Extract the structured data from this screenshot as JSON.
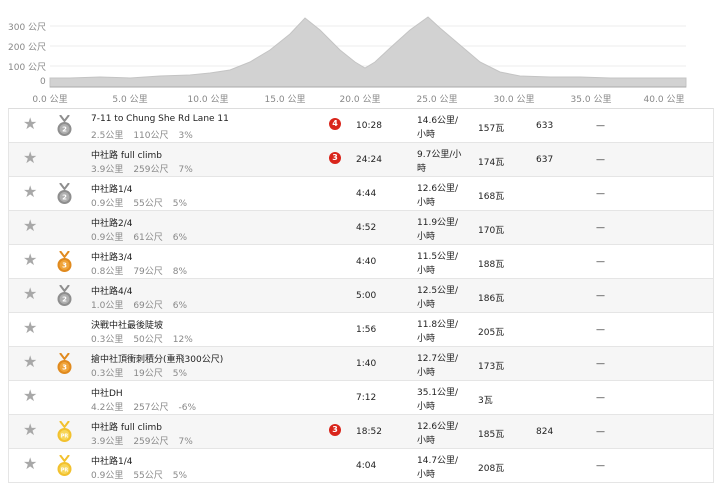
{
  "elevation": {
    "y_ticks": [
      "300 公尺",
      "200 公尺",
      "100 公尺",
      "0"
    ],
    "x_ticks": [
      "0.0 公里",
      "5.0 公里",
      "10.0 公里",
      "15.0 公里",
      "20.0 公里",
      "25.0 公里",
      "30.0 公里",
      "35.0 公里",
      "40.0 公里"
    ],
    "fill_color": "#d2d2d2"
  },
  "segments": [
    {
      "name": "7-11 to Chung She Rd Lane 11",
      "distance": "2.5公里",
      "elev": "110公尺",
      "grade": "3%",
      "medal": "silver",
      "medal_text": "2",
      "cat": "4",
      "time": "10:28",
      "speed1": "14.6公里/",
      "speed2": "小時",
      "power": "157瓦",
      "hr": "633",
      "vam": "—"
    },
    {
      "name": "中社路 full climb",
      "distance": "3.9公里",
      "elev": "259公尺",
      "grade": "7%",
      "medal": "",
      "medal_text": "",
      "cat": "3",
      "time": "24:24",
      "speed1": "9.7公里/小",
      "speed2": "時",
      "power": "174瓦",
      "hr": "637",
      "vam": "—"
    },
    {
      "name": "中社路1/4",
      "distance": "0.9公里",
      "elev": "55公尺",
      "grade": "5%",
      "medal": "silver",
      "medal_text": "2",
      "cat": "",
      "time": "4:44",
      "speed1": "12.6公里/",
      "speed2": "小時",
      "power": "168瓦",
      "hr": "",
      "vam": "—"
    },
    {
      "name": "中社路2/4",
      "distance": "0.9公里",
      "elev": "61公尺",
      "grade": "6%",
      "medal": "",
      "medal_text": "",
      "cat": "",
      "time": "4:52",
      "speed1": "11.9公里/",
      "speed2": "小時",
      "power": "170瓦",
      "hr": "",
      "vam": "—"
    },
    {
      "name": "中社路3/4",
      "distance": "0.8公里",
      "elev": "79公尺",
      "grade": "8%",
      "medal": "bronze",
      "medal_text": "3",
      "cat": "",
      "time": "4:40",
      "speed1": "11.5公里/",
      "speed2": "小時",
      "power": "188瓦",
      "hr": "",
      "vam": "—"
    },
    {
      "name": "中社路4/4",
      "distance": "1.0公里",
      "elev": "69公尺",
      "grade": "6%",
      "medal": "silver",
      "medal_text": "2",
      "cat": "",
      "time": "5:00",
      "speed1": "12.5公里/",
      "speed2": "小時",
      "power": "186瓦",
      "hr": "",
      "vam": "—"
    },
    {
      "name": "決戰中社最後陡坡",
      "distance": "0.3公里",
      "elev": "50公尺",
      "grade": "12%",
      "medal": "",
      "medal_text": "",
      "cat": "",
      "time": "1:56",
      "speed1": "11.8公里/",
      "speed2": "小時",
      "power": "205瓦",
      "hr": "",
      "vam": "—"
    },
    {
      "name": "搶中社頂衝刺積分(重飛300公尺)",
      "distance": "0.3公里",
      "elev": "19公尺",
      "grade": "5%",
      "medal": "bronze",
      "medal_text": "3",
      "cat": "",
      "time": "1:40",
      "speed1": "12.7公里/",
      "speed2": "小時",
      "power": "173瓦",
      "hr": "",
      "vam": "—"
    },
    {
      "name": "中社DH",
      "distance": "4.2公里",
      "elev": "257公尺",
      "grade": "-6%",
      "medal": "",
      "medal_text": "",
      "cat": "",
      "time": "7:12",
      "speed1": "35.1公里/",
      "speed2": "小時",
      "power": "3瓦",
      "hr": "",
      "vam": "—"
    },
    {
      "name": "中社路 full climb",
      "distance": "3.9公里",
      "elev": "259公尺",
      "grade": "7%",
      "medal": "gold",
      "medal_text": "PR",
      "cat": "3",
      "time": "18:52",
      "speed1": "12.6公里/",
      "speed2": "小時",
      "power": "185瓦",
      "hr": "824",
      "vam": "—"
    },
    {
      "name": "中社路1/4",
      "distance": "0.9公里",
      "elev": "55公尺",
      "grade": "5%",
      "medal": "gold",
      "medal_text": "PR",
      "cat": "",
      "time": "4:04",
      "speed1": "14.7公里/",
      "speed2": "小時",
      "power": "208瓦",
      "hr": "",
      "vam": "—"
    }
  ]
}
